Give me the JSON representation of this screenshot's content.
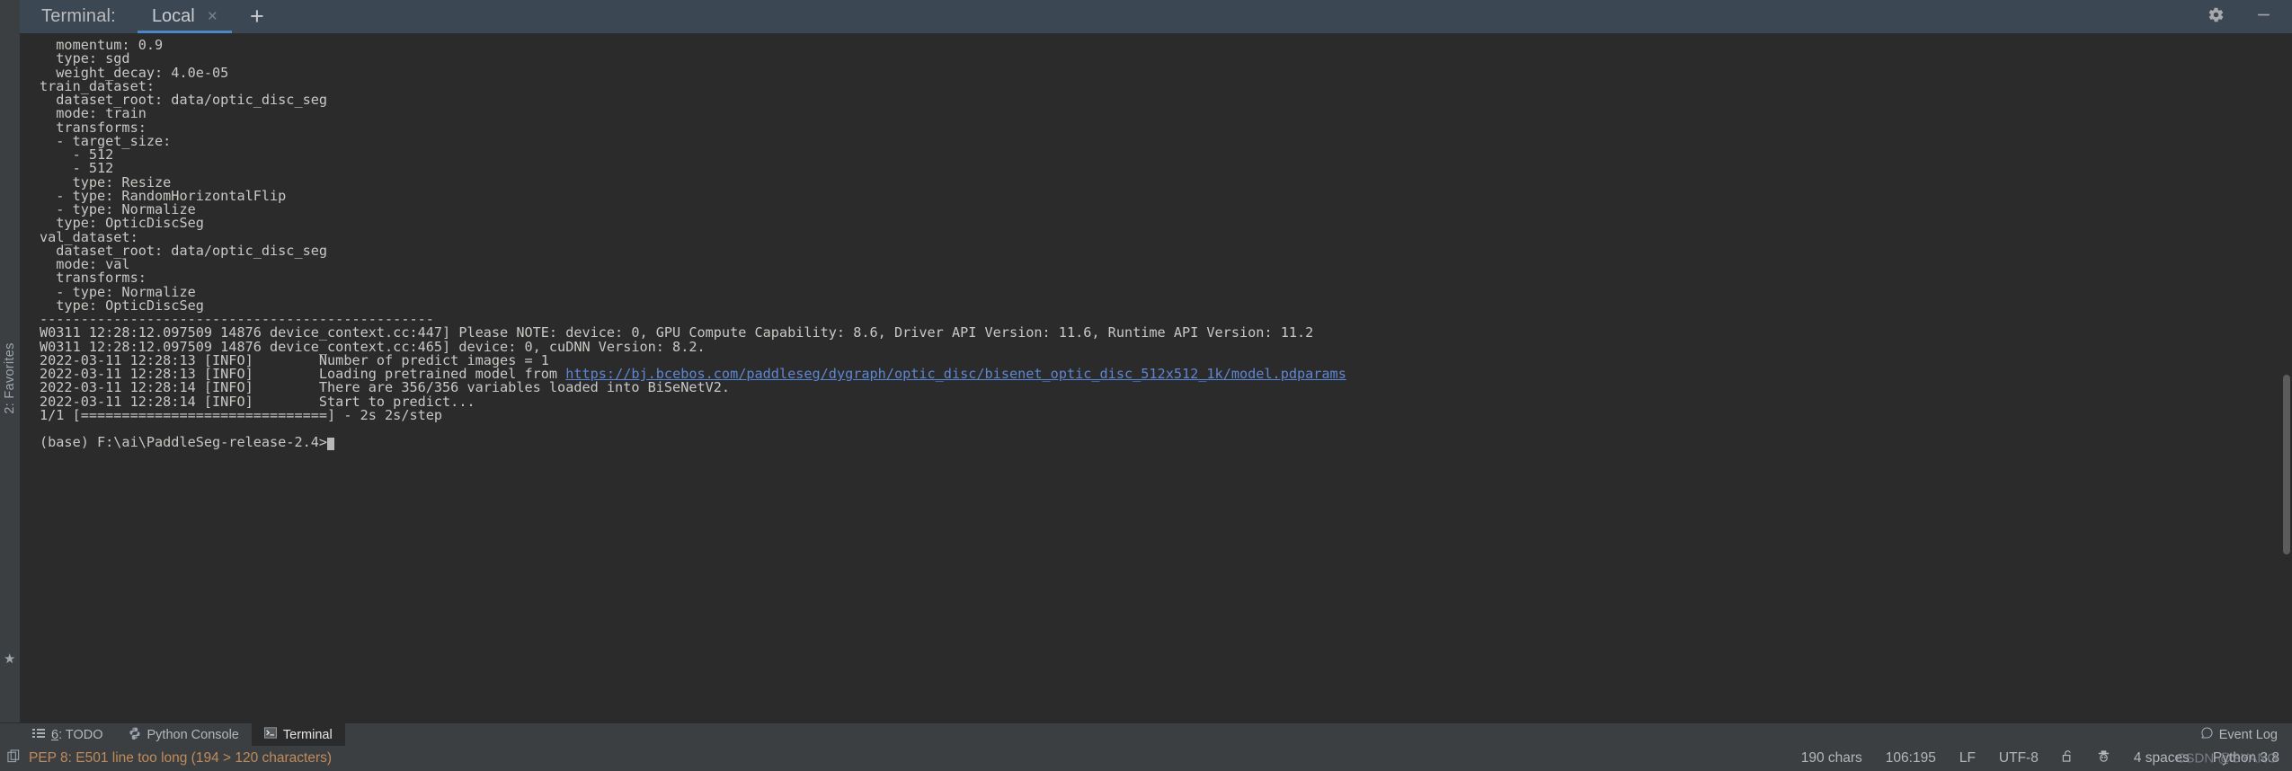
{
  "tabbar": {
    "title": "Terminal:",
    "tabs": [
      {
        "label": "Local",
        "close": "×",
        "active": true
      }
    ],
    "add_label": "+",
    "settings_icon": "gear-icon",
    "minimize_icon": "minimize-icon"
  },
  "favorites": {
    "label": "2: Favorites",
    "star": "★"
  },
  "terminal": {
    "lines": [
      {
        "text": "  momentum: 0.9"
      },
      {
        "text": "  type: sgd"
      },
      {
        "text": "  weight_decay: 4.0e-05"
      },
      {
        "text": "train_dataset:"
      },
      {
        "text": "  dataset_root: data/optic_disc_seg"
      },
      {
        "text": "  mode: train"
      },
      {
        "text": "  transforms:"
      },
      {
        "text": "  - target_size:"
      },
      {
        "text": "    - 512"
      },
      {
        "text": "    - 512"
      },
      {
        "text": "    type: Resize"
      },
      {
        "text": "  - type: RandomHorizontalFlip"
      },
      {
        "text": "  - type: Normalize"
      },
      {
        "text": "  type: OpticDiscSeg"
      },
      {
        "text": "val_dataset:"
      },
      {
        "text": "  dataset_root: data/optic_disc_seg"
      },
      {
        "text": "  mode: val"
      },
      {
        "text": "  transforms:"
      },
      {
        "text": "  - type: Normalize"
      },
      {
        "text": "  type: OpticDiscSeg"
      },
      {
        "text": "------------------------------------------------"
      },
      {
        "text": "W0311 12:28:12.097509 14876 device_context.cc:447] Please NOTE: device: 0, GPU Compute Capability: 8.6, Driver API Version: 11.6, Runtime API Version: 11.2"
      },
      {
        "text": "W0311 12:28:12.097509 14876 device_context.cc:465] device: 0, cuDNN Version: 8.2."
      },
      {
        "text": "2022-03-11 12:28:13 [INFO]\tNumber of predict images = 1"
      },
      {
        "pre": "2022-03-11 12:28:13 [INFO]\tLoading pretrained model from ",
        "url": "https://bj.bcebos.com/paddleseg/dygraph/optic_disc/bisenet_optic_disc_512x512_1k/model.pdparams"
      },
      {
        "text": "2022-03-11 12:28:14 [INFO]\tThere are 356/356 variables loaded into BiSeNetV2."
      },
      {
        "text": "2022-03-11 12:28:14 [INFO]\tStart to predict..."
      },
      {
        "text": "1/1 [==============================] - 2s 2s/step"
      },
      {
        "text": ""
      },
      {
        "prompt": "(base) F:\\ai\\PaddleSeg-release-2.4>",
        "cursor": true
      }
    ]
  },
  "toolwindow": {
    "items": [
      {
        "icon": "todo-icon",
        "prefix": "6",
        "label": ": TODO",
        "active": false
      },
      {
        "icon": "python-icon",
        "prefix": "",
        "label": "Python Console",
        "active": false
      },
      {
        "icon": "terminal-icon",
        "prefix": "",
        "label": "Terminal",
        "active": true
      }
    ],
    "event_log": {
      "icon": "event-log-icon",
      "label": "Event Log"
    }
  },
  "statusbar": {
    "inspection_icon": "inspection-icon",
    "inspection_text": "PEP 8: E501 line too long (194 > 120 characters)",
    "right_items": [
      {
        "name": "char-count",
        "label": "190 chars"
      },
      {
        "name": "caret-position",
        "label": "106:195"
      },
      {
        "name": "line-separator",
        "label": "LF"
      },
      {
        "name": "file-encoding",
        "label": "UTF-8"
      },
      {
        "name": "lock-icon",
        "label": "🔓"
      },
      {
        "name": "hacker-icon",
        "label": "🕵"
      },
      {
        "name": "indent-setting",
        "label": "4 spaces"
      },
      {
        "name": "interpreter",
        "label": "Python 3.8"
      }
    ],
    "watermark": "CSDN @SYANG"
  },
  "colors": {
    "accent": "#4a88c7",
    "terminal_bg": "#2b2b2b",
    "terminal_fg": "#c8c8c6",
    "link": "#5d87d4",
    "chrome": "#3c3f41",
    "tabbar": "#3c4754",
    "warning": "#c08b5c"
  }
}
